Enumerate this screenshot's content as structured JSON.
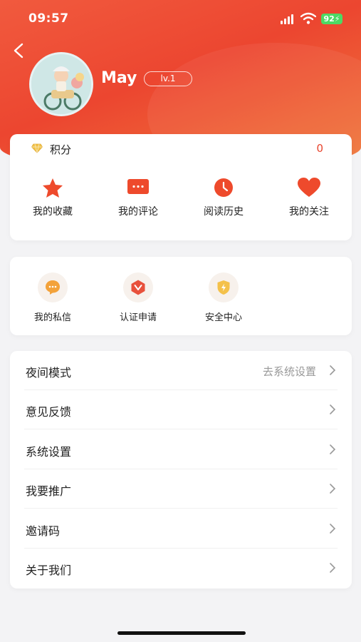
{
  "status_bar": {
    "time": "09:57",
    "battery": "92"
  },
  "profile": {
    "name": "May",
    "level": "lv.1"
  },
  "points": {
    "label": "积分",
    "value": "0"
  },
  "quick_actions": [
    {
      "label": "我的收藏",
      "icon": "star-icon"
    },
    {
      "label": "我的评论",
      "icon": "comment-icon"
    },
    {
      "label": "阅读历史",
      "icon": "clock-icon"
    },
    {
      "label": "我的关注",
      "icon": "heart-icon"
    }
  ],
  "services": [
    {
      "label": "我的私信",
      "icon": "message-icon"
    },
    {
      "label": "认证申请",
      "icon": "verify-icon"
    },
    {
      "label": "安全中心",
      "icon": "shield-icon"
    }
  ],
  "menu": [
    {
      "label": "夜间模式",
      "value": "去系统设置"
    },
    {
      "label": "意见反馈",
      "value": ""
    },
    {
      "label": "系统设置",
      "value": ""
    },
    {
      "label": "我要推广",
      "value": ""
    },
    {
      "label": "邀请码",
      "value": ""
    },
    {
      "label": "关于我们",
      "value": ""
    }
  ],
  "colors": {
    "accent": "#ec4630",
    "points_value": "#e8452e",
    "gold": "#e7b73b"
  }
}
